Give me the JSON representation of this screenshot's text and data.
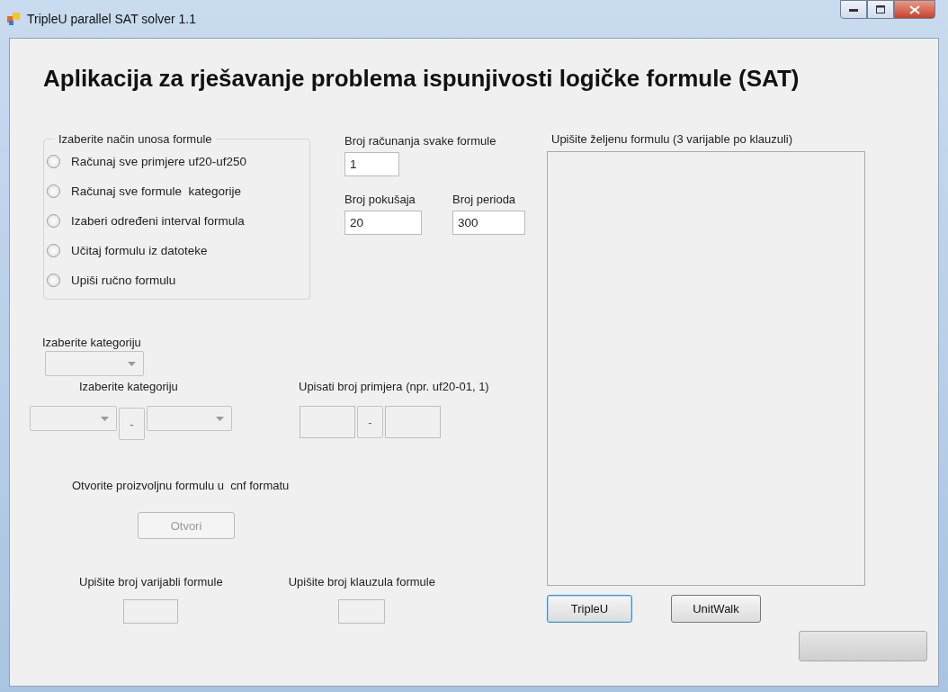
{
  "window": {
    "title": "TripleU parallel SAT solver 1.1"
  },
  "heading": "Aplikacija za rješavanje problema ispunjivosti logičke formule (SAT)",
  "input_mode": {
    "legend": "Izaberite način unosa formule",
    "options": [
      {
        "label": "Računaj sve primjere uf20-uf250",
        "selected": false
      },
      {
        "label": "Računaj sve formule  kategorije",
        "selected": false
      },
      {
        "label": "Izaberi određeni interval formula",
        "selected": false
      },
      {
        "label": "Učitaj formulu iz datoteke",
        "selected": false
      },
      {
        "label": "Upiši ručno formulu",
        "selected": false
      }
    ]
  },
  "runs": {
    "label": "Broj računanja svake formule",
    "value": "1"
  },
  "tries": {
    "label": "Broj pokušaja",
    "value": "20"
  },
  "periods": {
    "label": "Broj perioda",
    "value": "300"
  },
  "category": {
    "label": "Izaberite kategoriju",
    "disabled": true
  },
  "category_range": {
    "label": "Izaberite kategoriju",
    "separator": "-",
    "disabled": true
  },
  "example_range": {
    "label": "Upisati broj primjera (npr. uf20-01, 1)",
    "separator": "-",
    "disabled": true
  },
  "open_file": {
    "label": "Otvorite proizvoljnu formulu u  cnf formatu",
    "button": "Otvori",
    "disabled": true
  },
  "variables": {
    "label": "Upišite broj varijabli formule",
    "disabled": true
  },
  "clauses": {
    "label": "Upišite broj klauzula formule",
    "disabled": true
  },
  "formula": {
    "label": "Upišite željenu formulu (3 varijable po klauzuli)"
  },
  "buttons": [
    {
      "label": "TripleU",
      "selected": true
    },
    {
      "label": "UnitWalk",
      "selected": false
    }
  ],
  "progress": {
    "level": 0
  }
}
